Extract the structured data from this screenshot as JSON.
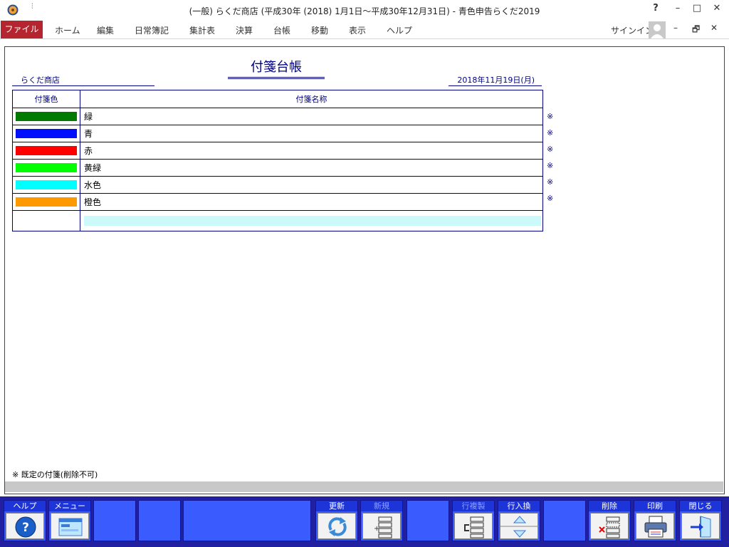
{
  "titlebar": {
    "title": "(一般) らくだ商店 (平成30年 (2018) 1月1日～平成30年12月31日) - 青色申告らくだ2019",
    "qa_arrow": "⫶",
    "help": "?",
    "minimize": "–",
    "maximize": "□",
    "close": "✕"
  },
  "menu": {
    "file": "ファイル",
    "items": [
      "ホーム",
      "編集",
      "日常簿記",
      "集計表",
      "決算",
      "台帳",
      "移動",
      "表示",
      "ヘルプ"
    ],
    "signin": "サインイン",
    "doc_minimize": "–",
    "doc_restore": "🗗",
    "doc_close": "✕"
  },
  "document": {
    "title": "付箋台帳",
    "shop": "らくだ商店",
    "date": "2018年11月19日(月)",
    "columns": {
      "color": "付箋色",
      "name": "付箋名称"
    },
    "rows": [
      {
        "color": "#007a00",
        "name": "緑",
        "mark": "※"
      },
      {
        "color": "#0010ff",
        "name": "青",
        "mark": "※"
      },
      {
        "color": "#ff0000",
        "name": "赤",
        "mark": "※"
      },
      {
        "color": "#00ff00",
        "name": "黄緑",
        "mark": "※"
      },
      {
        "color": "#00ffff",
        "name": "水色",
        "mark": "※"
      },
      {
        "color": "#ff9900",
        "name": "橙色",
        "mark": "※"
      }
    ],
    "new_row_value": "",
    "footnote": "※ 既定の付箋(削除不可)"
  },
  "fkeys": [
    {
      "label": "ヘルプ",
      "icon": "help-circle-icon",
      "enabled": true
    },
    {
      "label": "メニュー",
      "icon": "menu-window-icon",
      "enabled": true
    },
    {
      "label": "",
      "icon": "",
      "enabled": false
    },
    {
      "label": "",
      "icon": "",
      "enabled": false
    },
    {
      "label": "",
      "icon": "",
      "enabled": false
    },
    {
      "label": "更新",
      "icon": "refresh-arrows-icon",
      "enabled": true
    },
    {
      "label": "新規",
      "icon": "new-record-icon",
      "enabled": false
    },
    {
      "label": "",
      "icon": "",
      "enabled": false
    },
    {
      "label": "行複製",
      "icon": "copy-row-icon",
      "enabled": false
    },
    {
      "label": "行入換",
      "icon": "swap-rows-icon",
      "enabled": true
    },
    {
      "label": "",
      "icon": "",
      "enabled": false
    },
    {
      "label": "削除",
      "icon": "delete-row-icon",
      "enabled": true
    },
    {
      "label": "印刷",
      "icon": "printer-icon",
      "enabled": true
    },
    {
      "label": "閉じる",
      "icon": "exit-door-icon",
      "enabled": true
    }
  ],
  "colors": {
    "accent": "#b5252f",
    "navy": "#000080",
    "fkey_bg": "#2020a0",
    "fkey_btn": "#3a5cff"
  }
}
